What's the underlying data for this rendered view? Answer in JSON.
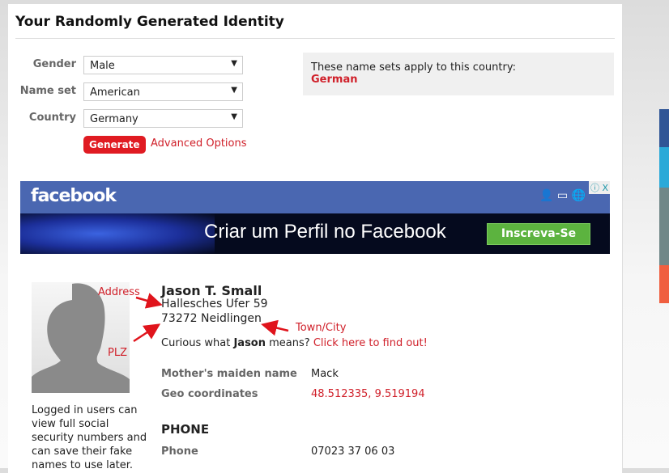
{
  "title": "Your Randomly Generated Identity",
  "form": {
    "gender_label": "Gender",
    "gender_value": "Male",
    "nameset_label": "Name set",
    "nameset_value": "American",
    "country_label": "Country",
    "country_value": "Germany",
    "generate": "Generate",
    "advanced": "Advanced Options"
  },
  "note": {
    "text": "These name sets apply to this country:",
    "country": "German"
  },
  "ad": {
    "brand": "facebook",
    "headline": "Criar um Perfil no Facebook",
    "cta": "Inscreva-Se",
    "close": "X"
  },
  "annotations": {
    "address": "Address",
    "plz": "PLZ",
    "city": "Town/City"
  },
  "identity": {
    "name": "Jason T. Small",
    "street": "Hallesches Ufer 59",
    "city": "73272 Neidlingen",
    "curious_pre": "Curious what ",
    "first": "Jason",
    "curious_post": " means? ",
    "link": "Click here to find out!",
    "maiden_label": "Mother's maiden name",
    "maiden": "Mack",
    "geo_label": "Geo coordinates",
    "geo": "48.512335, 9.519194",
    "phone_heading": "PHONE",
    "phone_label": "Phone",
    "phone": "07023 37 06 03"
  },
  "login_note": "Logged in users can view full social security numbers and can save their fake names to use later.",
  "social_colors": [
    "#2f5596",
    "#2aa9d8",
    "#708788",
    "#f05f40"
  ]
}
